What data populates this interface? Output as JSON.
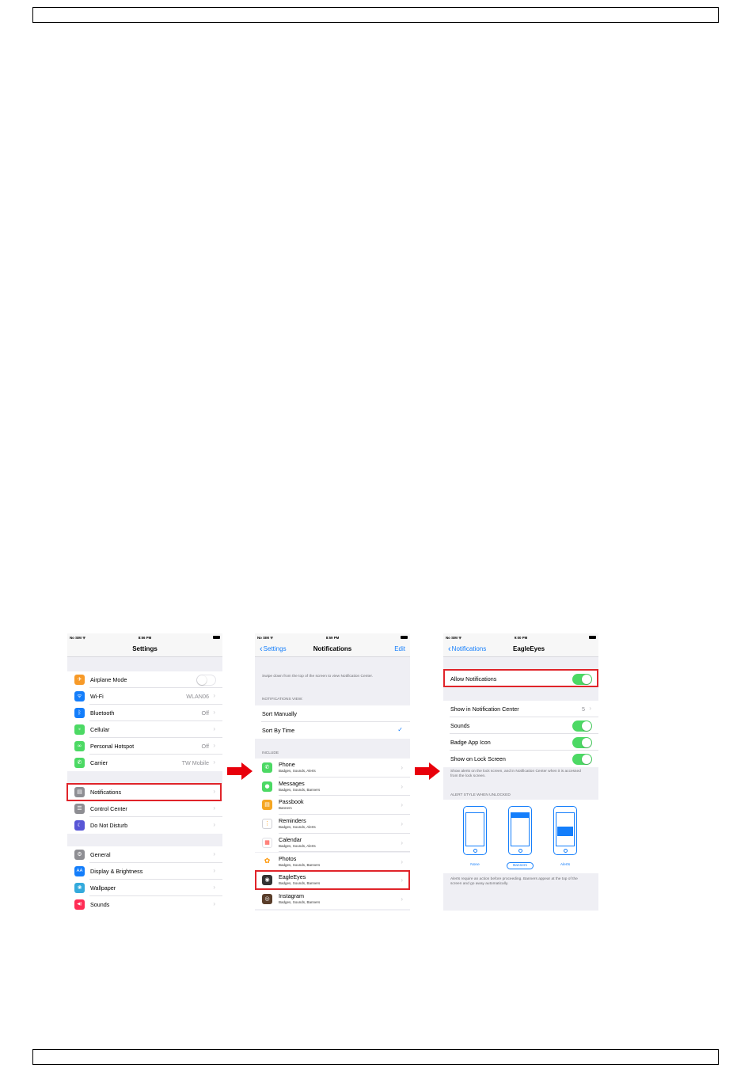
{
  "screens": {
    "settings": {
      "status": {
        "carrier": "No SIM ᯤ",
        "time": "8:56 PM"
      },
      "title": "Settings",
      "group1": [
        {
          "label": "Airplane Mode",
          "value": "",
          "icon": "airplane-icon",
          "glyph": "✈",
          "color": "#f79a28",
          "toggle": "off"
        },
        {
          "label": "Wi-Fi",
          "value": "WLAN06",
          "icon": "wifi-icon",
          "glyph": "ᯤ",
          "color": "#147efb"
        },
        {
          "label": "Bluetooth",
          "value": "Off",
          "icon": "bluetooth-icon",
          "glyph": "ᛒ",
          "color": "#147efb"
        },
        {
          "label": "Cellular",
          "value": "",
          "icon": "cellular-icon",
          "glyph": "⍤",
          "color": "#4cd964"
        },
        {
          "label": "Personal Hotspot",
          "value": "Off",
          "icon": "hotspot-icon",
          "glyph": "∞",
          "color": "#4cd964"
        },
        {
          "label": "Carrier",
          "value": "TW Mobile",
          "icon": "phone-icon",
          "glyph": "✆",
          "color": "#4cd964"
        }
      ],
      "group2": [
        {
          "label": "Notifications",
          "icon": "notifications-icon",
          "glyph": "▤",
          "color": "#8e8e93"
        },
        {
          "label": "Control Center",
          "icon": "control-center-icon",
          "glyph": "☰",
          "color": "#8e8e93"
        },
        {
          "label": "Do Not Disturb",
          "icon": "moon-icon",
          "glyph": "☾",
          "color": "#5856d6"
        }
      ],
      "group3": [
        {
          "label": "General",
          "icon": "gear-icon",
          "glyph": "⚙",
          "color": "#8e8e93"
        },
        {
          "label": "Display & Brightness",
          "icon": "display-icon",
          "glyph": "AA",
          "color": "#147efb"
        },
        {
          "label": "Wallpaper",
          "icon": "wallpaper-icon",
          "glyph": "❀",
          "color": "#34aadc"
        },
        {
          "label": "Sounds",
          "icon": "speaker-icon",
          "glyph": "◀)",
          "color": "#ff2d55"
        }
      ]
    },
    "notifications": {
      "status": {
        "carrier": "No SIM ᯤ",
        "time": "8:59 PM"
      },
      "back": "Settings",
      "title": "Notifications",
      "edit": "Edit",
      "swipe_note": "Swipe down from the top of the screen to view Notification Center.",
      "view_header": "NOTIFICATIONS VIEW:",
      "sort_manually": "Sort Manually",
      "sort_by_time": "Sort By Time",
      "include_header": "INCLUDE",
      "apps": [
        {
          "name": "Phone",
          "sub": "Badges, Sounds, Alerts",
          "icon": "phone-app-icon",
          "glyph": "✆",
          "color": "#4cd964"
        },
        {
          "name": "Messages",
          "sub": "Badges, Sounds, Banners",
          "icon": "messages-icon",
          "glyph": "●",
          "color": "#4cd964"
        },
        {
          "name": "Passbook",
          "sub": "Banners",
          "icon": "passbook-icon",
          "glyph": "▤",
          "color": "#f5a623"
        },
        {
          "name": "Reminders",
          "sub": "Badges, Sounds, Alerts",
          "icon": "reminders-icon",
          "glyph": "⋮",
          "color": "#d0d0d5"
        },
        {
          "name": "Calendar",
          "sub": "Badges, Sounds, Alerts",
          "icon": "calendar-icon",
          "glyph": "▦",
          "color": "#ff3b30"
        },
        {
          "name": "Photos",
          "sub": "Badges, Sounds, Banners",
          "icon": "photos-icon",
          "glyph": "✿",
          "color": "#ff9500"
        },
        {
          "name": "EagleEyes",
          "sub": "Badges, Sounds, Banners",
          "icon": "eagleeyes-icon",
          "glyph": "◉",
          "color": "#333333"
        },
        {
          "name": "Instagram",
          "sub": "Badges, Sounds, Banners",
          "icon": "instagram-icon",
          "glyph": "◎",
          "color": "#5a3e2b"
        }
      ]
    },
    "eagleeyes": {
      "status": {
        "carrier": "No SIM ᯤ",
        "time": "9:00 PM"
      },
      "back": "Notifications",
      "title": "EagleEyes",
      "allow": "Allow Notifications",
      "show_center": "Show in Notification Center",
      "show_center_value": "5",
      "sounds": "Sounds",
      "badge": "Badge App Icon",
      "lock": "Show on Lock Screen",
      "lock_note": "Show alerts on the lock screen, and in Notification Center when it is accessed from the lock screen.",
      "style_header": "ALERT STYLE WHEN UNLOCKED",
      "styles": {
        "none": "None",
        "banners": "Banners",
        "alerts": "Alerts"
      },
      "selected_style": "Banners",
      "bottom_note": "Alerts require an action before proceeding. Banners appear at the top of the screen and go away automatically."
    }
  },
  "colors": {
    "accent": "#147efb",
    "switch_on": "#4cd964",
    "highlight": "#e0242a",
    "arrow": "#e8000b"
  }
}
